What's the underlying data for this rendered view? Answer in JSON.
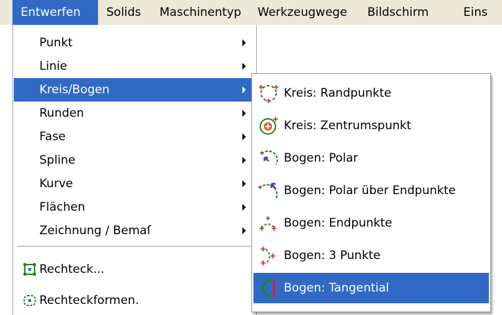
{
  "menubar": {
    "items": [
      "Entwerfen",
      "Solids",
      "Maschinentyp",
      "Werkzeugwege",
      "Bildschirm",
      "Eins"
    ]
  },
  "main_menu": {
    "items": [
      {
        "label": "Punkt"
      },
      {
        "label": "Linie"
      },
      {
        "label": "Kreis/Bogen"
      },
      {
        "label": "Runden"
      },
      {
        "label": "Fase"
      },
      {
        "label": "Spline"
      },
      {
        "label": "Kurve"
      },
      {
        "label": "Flächen"
      },
      {
        "label": "Zeichnung / Bemaſ"
      },
      {
        "label": "Rechteck..."
      },
      {
        "label": "Rechteckformen."
      }
    ]
  },
  "submenu": {
    "items": [
      {
        "label": "Kreis: Randpunkte",
        "icon": "circle-edge-points-icon"
      },
      {
        "label": "Kreis: Zentrumspunkt",
        "icon": "circle-center-point-icon"
      },
      {
        "label": "Bogen: Polar",
        "icon": "arc-polar-icon"
      },
      {
        "label": "Bogen: Polar über Endpunkte",
        "icon": "arc-polar-endpoints-icon"
      },
      {
        "label": "Bogen: Endpunkte",
        "icon": "arc-endpoints-icon"
      },
      {
        "label": "Bogen: 3 Punkte",
        "icon": "arc-3-points-icon"
      },
      {
        "label": "Bogen: Tangential",
        "icon": "arc-tangential-icon"
      }
    ]
  },
  "colors": {
    "menubar_bg": "#ece9d8",
    "highlight": "#316ac5",
    "icon_green": "#1a8a1a",
    "icon_red": "#e02020"
  }
}
